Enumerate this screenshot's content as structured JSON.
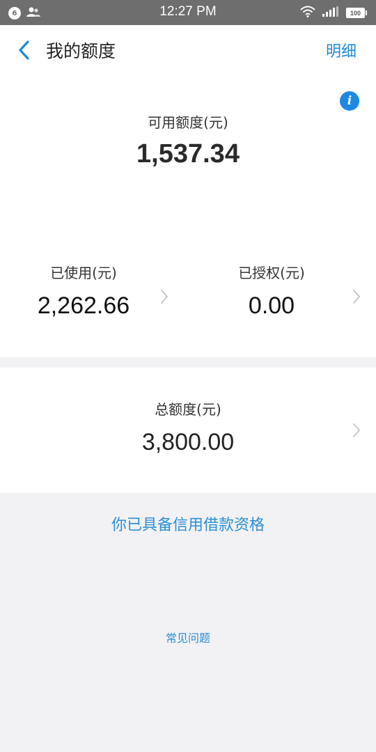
{
  "status_bar": {
    "notification_count": "6",
    "time": "12:27 PM",
    "battery": "100"
  },
  "nav": {
    "title": "我的额度",
    "detail_label": "明细"
  },
  "available": {
    "label": "可用额度(元)",
    "value": "1,537.34"
  },
  "used": {
    "label": "已使用(元)",
    "value": "2,262.66"
  },
  "authorized": {
    "label": "已授权(元)",
    "value": "0.00"
  },
  "total": {
    "label": "总额度(元)",
    "value": "3,800.00"
  },
  "eligibility_text": "你已具备信用借款资格",
  "faq_label": "常见问题",
  "colors": {
    "accent": "#1e88d4",
    "status_bar": "#6e6e6e",
    "background": "#f2f2f5"
  }
}
